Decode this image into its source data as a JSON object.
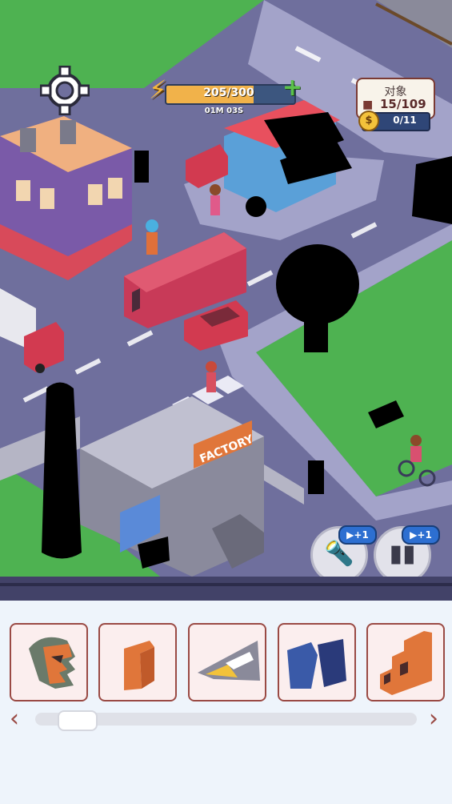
{
  "hud": {
    "energy_text": "205/300",
    "energy_fraction": 0.683,
    "timer": "01M 03S",
    "objects_label": "对象",
    "objects_count": "15/109",
    "coin_count": "0/11",
    "coin_symbol": "$"
  },
  "scene": {
    "factory_sign": "FACTORY"
  },
  "hints": [
    {
      "name": "flashlight",
      "badge": "▶+1"
    },
    {
      "name": "chart",
      "badge": "▶+1"
    }
  ],
  "tray": {
    "left_arrow": "‹",
    "right_arrow": "›",
    "scroll_fraction": 0.1,
    "items": [
      {
        "icon": "helmet-piece-icon"
      },
      {
        "icon": "orange-chair-icon"
      },
      {
        "icon": "crosswalk-piece-icon"
      },
      {
        "icon": "blue-chairs-icon"
      },
      {
        "icon": "orange-staircase-icon"
      }
    ]
  },
  "colors": {
    "road": "#6f6f9d",
    "grass": "#4eb251",
    "accent": "#9a4a44",
    "energy": "#f1b24a"
  }
}
